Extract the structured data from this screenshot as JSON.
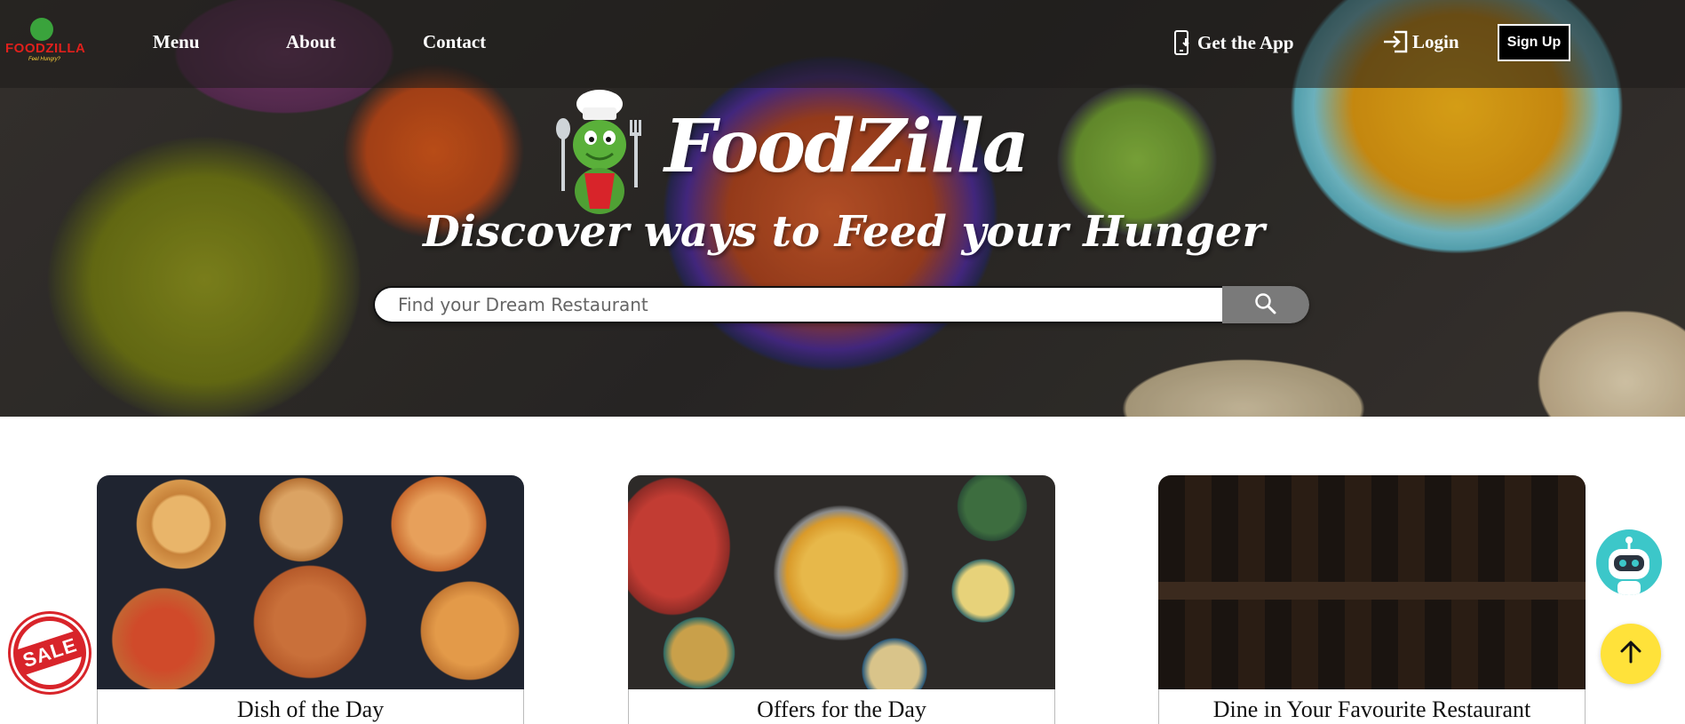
{
  "brand": {
    "logo_text": "FOODZILLA",
    "logo_tagline": "Feel Hungry?",
    "title": "FoodZilla",
    "tagline": "Discover ways to Feed your Hunger"
  },
  "nav": {
    "menu": "Menu",
    "about": "About",
    "contact": "Contact",
    "get_app": "Get the App",
    "login": "Login",
    "signup": "Sign Up"
  },
  "search": {
    "placeholder": "Find your Dream Restaurant"
  },
  "cards": [
    {
      "title": "Dish of the Day",
      "icon": "pizza-image"
    },
    {
      "title": "Offers for the Day",
      "icon": "paella-spread-image"
    },
    {
      "title": "Dine in Your Favourite Restaurant",
      "icon": "restaurant-interior-image"
    }
  ],
  "floating": {
    "sale_label": "SALE",
    "chatbot_icon": "robot-icon",
    "scroll_top_icon": "arrow-up-icon"
  },
  "colors": {
    "signup_bg": "#000000",
    "search_button": "#7a7a7a",
    "scroll_top": "#ffe23a",
    "chatbot": "#3cc7c9",
    "sale_red": "#d8242a"
  }
}
